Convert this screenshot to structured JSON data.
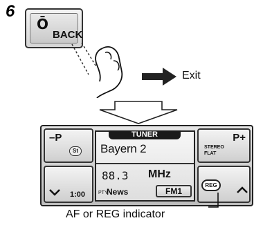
{
  "step": {
    "number": "6"
  },
  "back_button": {
    "label": "BACK",
    "symbol": "Ō"
  },
  "exit_label": "Exit",
  "display": {
    "tuner_tab": "TUNER",
    "station_name": "Bayern 2",
    "frequency": "88.3",
    "frequency_unit": "MHz",
    "pty_prefix": "PTY",
    "pty_value": "News",
    "band": "FM1",
    "preset_down": "–P",
    "preset_up": "P+",
    "st_badge": "St",
    "stereo_label": "STEREO",
    "flat_label": "FLAT",
    "clock": "1:00",
    "reg_badge": "REG"
  },
  "indicator_caption": "AF or REG indicator",
  "colors": {
    "panel": "#cfcfcf",
    "screen": "#ececec",
    "arrow": "#222222"
  }
}
